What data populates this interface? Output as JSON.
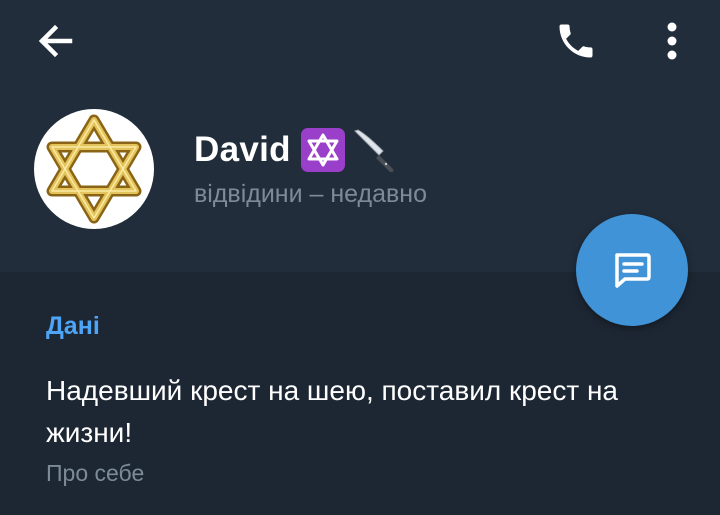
{
  "header": {
    "back_icon": "arrow-left-icon",
    "call_icon": "phone-icon",
    "more_icon": "more-vertical-icon"
  },
  "profile": {
    "name": "David",
    "name_emojis": [
      "star-of-david-emoji",
      "knife-emoji"
    ],
    "avatar": "star-of-david-gold",
    "status": "відвідини – недавно"
  },
  "fab": {
    "icon": "message-icon",
    "color": "#3f93d6"
  },
  "info": {
    "section_title": "Дані",
    "bio": "Надевший крест на шею, поставил крест на жизни!",
    "bio_label": "Про себе"
  },
  "colors": {
    "background": "#1d2733",
    "header": "#212d3b",
    "accent": "#4ea4f6",
    "muted": "#7d8b99"
  }
}
